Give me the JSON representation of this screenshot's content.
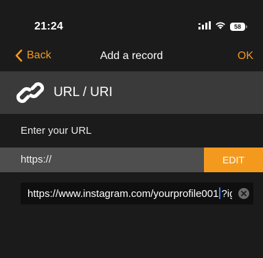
{
  "status": {
    "time": "21:24",
    "battery": "58"
  },
  "nav": {
    "back_label": "Back",
    "title": "Add a record",
    "ok_label": "OK"
  },
  "record_type": {
    "label": "URL / URI",
    "icon": "link-icon"
  },
  "form": {
    "prompt": "Enter your URL",
    "prefix": "https://",
    "edit_label": "EDIT",
    "url_before_caret": "https://www.instagram.com/yourprofile001",
    "url_after_caret": "?igsh"
  },
  "colors": {
    "accent": "#f39a1e",
    "background": "#1b1b1c",
    "header": "#3a3a3b",
    "prefix_row": "#4e4e4f",
    "caret": "#3d7cff"
  }
}
